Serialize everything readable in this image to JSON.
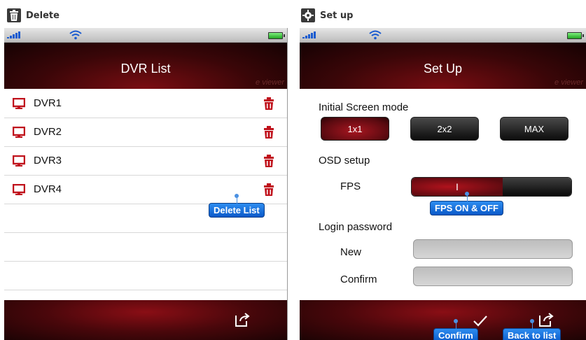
{
  "left_caption": {
    "label": "Delete",
    "icon": "trash-icon"
  },
  "right_caption": {
    "label": "Set up",
    "icon": "gear-icon"
  },
  "dvr_screen": {
    "title": "DVR List",
    "brand": "e viewer",
    "items": [
      {
        "name": "DVR1",
        "icon": "monitor-icon",
        "action_icon": "trash-icon"
      },
      {
        "name": "DVR2",
        "icon": "monitor-icon",
        "action_icon": "trash-icon"
      },
      {
        "name": "DVR3",
        "icon": "monitor-icon",
        "action_icon": "trash-icon"
      },
      {
        "name": "DVR4",
        "icon": "monitor-icon",
        "action_icon": "trash-icon"
      }
    ],
    "delete_tip": "Delete List",
    "toolbar_icon": "export-icon"
  },
  "setup_screen": {
    "title": "Set Up",
    "brand": "e viewer",
    "initial_mode_label": "Initial Screen mode",
    "modes": [
      {
        "label": "1x1",
        "selected": true
      },
      {
        "label": "2x2",
        "selected": false
      },
      {
        "label": "MAX",
        "selected": false
      }
    ],
    "osd_label": "OSD setup",
    "fps_label": "FPS",
    "fps_toggle_on_text": "I",
    "fps_tip": "FPS ON & OFF",
    "login_label": "Login password",
    "new_label": "New",
    "new_value": "",
    "confirm_label": "Confirm",
    "confirm_value": "",
    "confirm_tip": "Confirm",
    "back_tip": "Back to list"
  },
  "colors": {
    "accent_red": "#8a0e15",
    "tip_blue": "#0a59c9",
    "icon_red": "#c0121c"
  }
}
